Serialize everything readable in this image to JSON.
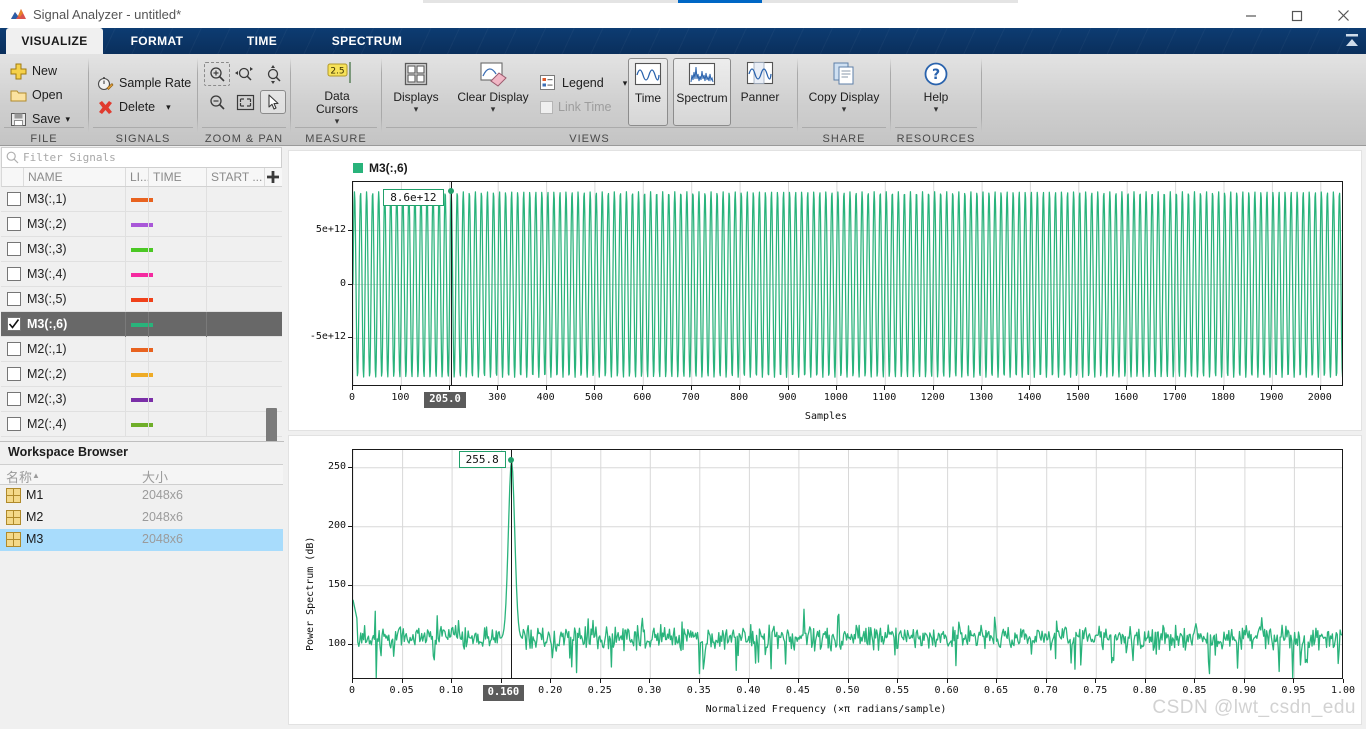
{
  "window": {
    "title": "Signal Analyzer - untitled*",
    "logo_icon": "matlab-signal-analyzer-icon",
    "minimize_label": "—",
    "maximize_label": "□",
    "close_label": "✕"
  },
  "ribbon": {
    "tabs": [
      {
        "label": "VISUALIZE",
        "active": true
      },
      {
        "label": "FORMAT",
        "active": false
      },
      {
        "label": "TIME",
        "active": false
      },
      {
        "label": "SPECTRUM",
        "active": false
      }
    ],
    "collapse_icon": "collapse-ribbon-icon",
    "groups": [
      {
        "name": "FILE",
        "label": "FILE",
        "items": [
          {
            "label": "New",
            "icon": "new-plus-icon"
          },
          {
            "label": "Open",
            "icon": "open-folder-icon"
          },
          {
            "label": "Save",
            "icon": "save-disk-icon",
            "caret": "▾"
          }
        ]
      },
      {
        "name": "SIGNALS",
        "label": "SIGNALS",
        "items": [
          {
            "label": "Sample Rate",
            "icon": "sample-rate-clock-icon"
          },
          {
            "label": "Delete",
            "icon": "delete-x-icon",
            "caret": "▾"
          }
        ]
      },
      {
        "name": "ZOOM & PAN",
        "label": "ZOOM & PAN",
        "items": [
          {
            "icon": "zoom-in-region-icon"
          },
          {
            "icon": "zoom-x-icon"
          },
          {
            "icon": "zoom-y-icon"
          },
          {
            "icon": "zoom-out-icon"
          },
          {
            "icon": "fit-to-view-icon"
          },
          {
            "icon": "pan-pointer-icon",
            "selected": true
          }
        ]
      },
      {
        "name": "MEASURE",
        "label": "MEASURE",
        "items": [
          {
            "label": "Data Cursors",
            "icon": "data-cursors-icon",
            "badge": "2.5",
            "caret": "▾"
          }
        ]
      },
      {
        "name": "VIEWS",
        "label": "VIEWS",
        "items": [
          {
            "label": "Displays",
            "icon": "displays-grid-icon",
            "caret": "▾"
          },
          {
            "label": "Clear Display",
            "icon": "clear-display-eraser-icon",
            "caret": "▾"
          },
          {
            "label": "Legend",
            "icon": "legend-icon",
            "caret": "▾"
          },
          {
            "label": "Link Time",
            "icon": "link-time-checkbox",
            "disabled": true
          },
          {
            "label": "Time",
            "icon": "time-waveform-icon",
            "framed": true
          },
          {
            "label": "Spectrum",
            "icon": "spectrum-icon",
            "framed": true
          },
          {
            "label": "Panner",
            "icon": "panner-icon"
          }
        ]
      },
      {
        "name": "SHARE",
        "label": "SHARE",
        "items": [
          {
            "label": "Copy Display",
            "icon": "copy-display-icon",
            "caret": "▾"
          }
        ]
      },
      {
        "name": "RESOURCES",
        "label": "RESOURCES",
        "items": [
          {
            "label": "Help",
            "icon": "help-question-icon",
            "caret": "▾"
          }
        ]
      }
    ]
  },
  "signal_browser": {
    "filter_placeholder": "Filter Signals",
    "search_icon": "search-icon",
    "add_column_icon": "add-column-plus-icon",
    "columns": [
      "NAME",
      "LI...",
      "TIME",
      "START ..."
    ],
    "rows": [
      {
        "name": "M3(:,1)",
        "color": "#e8621f",
        "checked": false,
        "selected": false
      },
      {
        "name": "M3(:,2)",
        "color": "#a957d8",
        "checked": false,
        "selected": false
      },
      {
        "name": "M3(:,3)",
        "color": "#4bc824",
        "checked": false,
        "selected": false
      },
      {
        "name": "M3(:,4)",
        "color": "#f52aa0",
        "checked": false,
        "selected": false
      },
      {
        "name": "M3(:,5)",
        "color": "#f0411a",
        "checked": false,
        "selected": false
      },
      {
        "name": "M3(:,6)",
        "color": "#29b37b",
        "checked": true,
        "selected": true
      },
      {
        "name": "M2(:,1)",
        "color": "#e8621f",
        "checked": false,
        "selected": false
      },
      {
        "name": "M2(:,2)",
        "color": "#eeab26",
        "checked": false,
        "selected": false
      },
      {
        "name": "M2(:,3)",
        "color": "#7b2fa8",
        "checked": false,
        "selected": false
      },
      {
        "name": "M2(:,4)",
        "color": "#6fae29",
        "checked": false,
        "selected": false
      }
    ]
  },
  "workspace_browser": {
    "title": "Workspace Browser",
    "columns": [
      "名称",
      "大小"
    ],
    "sort_arrow": "▲",
    "rows": [
      {
        "icon": "matrix-variable-icon",
        "name": "M1",
        "size": "2048x6",
        "selected": false
      },
      {
        "icon": "matrix-variable-icon",
        "name": "M2",
        "size": "2048x6",
        "selected": false
      },
      {
        "icon": "matrix-variable-icon",
        "name": "M3",
        "size": "2048x6",
        "selected": true
      }
    ]
  },
  "accent": {
    "signal_green": "#29b37b",
    "ribbon_blue": "#0a2f5c",
    "selection_blue": "#a8dcfc"
  },
  "watermark": "CSDN @lwt_csdn_edu",
  "chart_data": [
    {
      "id": "time_plot",
      "type": "line",
      "title": "",
      "legend": [
        "M3(:,6)"
      ],
      "legend_position": "top-left",
      "xlabel": "Samples",
      "ylabel": "",
      "xlim": [
        0,
        2048
      ],
      "ylim": [
        -9500000000000.0,
        9500000000000.0
      ],
      "xticks": [
        0,
        100,
        200,
        300,
        400,
        500,
        600,
        700,
        800,
        900,
        1000,
        1100,
        1200,
        1300,
        1400,
        1500,
        1600,
        1700,
        1800,
        1900,
        2000
      ],
      "xticklabels": [
        "0",
        "100",
        "200",
        "300",
        "400",
        "500",
        "600",
        "700",
        "800",
        "900",
        "1000",
        "1100",
        "1200",
        "1300",
        "1400",
        "1500",
        "1600",
        "1700",
        "1800",
        "1900",
        "2000"
      ],
      "yticks": [
        -5000000000000.0,
        0,
        5000000000000.0
      ],
      "yticklabels": [
        "-5e+12",
        "0",
        "5e+12"
      ],
      "grid": true,
      "series_color": "#29b37b",
      "waveform": {
        "kind": "sine-dense",
        "amplitude": 8600000000000.0,
        "cycles": 164
      },
      "cursor": {
        "x_label": "205.0",
        "x_value": 205.0,
        "y_label": "8.6e+12",
        "y_value": 8600000000000.0
      }
    },
    {
      "id": "spectrum_plot",
      "type": "line",
      "title": "",
      "xlabel": "Normalized Frequency (×π radians/sample)",
      "ylabel": "Power Spectrum (dB)",
      "xlim": [
        0,
        1.0
      ],
      "ylim": [
        70,
        265
      ],
      "xticks": [
        0,
        0.05,
        0.1,
        0.15,
        0.2,
        0.25,
        0.3,
        0.35,
        0.4,
        0.45,
        0.5,
        0.55,
        0.6,
        0.65,
        0.7,
        0.75,
        0.8,
        0.85,
        0.9,
        0.95,
        1.0
      ],
      "xticklabels": [
        "0",
        "0.05",
        "0.10",
        "0.15",
        "0.20",
        "0.25",
        "0.30",
        "0.35",
        "0.40",
        "0.45",
        "0.50",
        "0.55",
        "0.60",
        "0.65",
        "0.70",
        "0.75",
        "0.80",
        "0.85",
        "0.90",
        "0.95",
        "1.00"
      ],
      "yticks": [
        100,
        150,
        200,
        250
      ],
      "yticklabels": [
        "100",
        "150",
        "200",
        "250"
      ],
      "grid": true,
      "series_color": "#29b37b",
      "noise_floor_db": 105,
      "peak": {
        "frequency": 0.16,
        "power_db": 255.8
      },
      "cursor": {
        "x_label": "0.160",
        "x_value": 0.16,
        "y_label": "255.8",
        "y_value": 255.8
      }
    }
  ]
}
